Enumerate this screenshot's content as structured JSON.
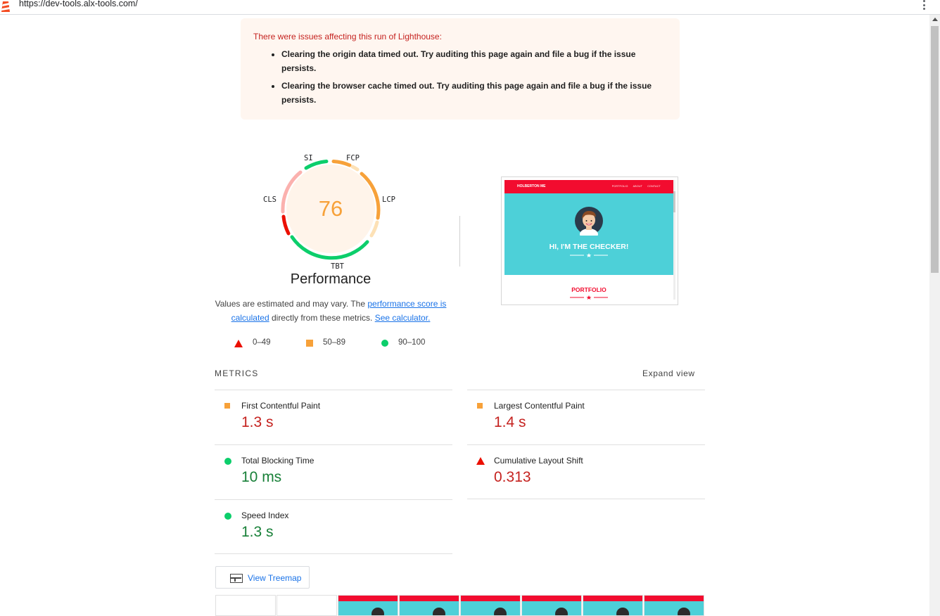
{
  "browser": {
    "url": "https://dev-tools.alx-tools.com/"
  },
  "warning": {
    "title": "There were issues affecting this run of Lighthouse:",
    "items": [
      "Clearing the origin data timed out. Try auditing this page again and file a bug if the issue persists.",
      "Clearing the browser cache timed out. Try auditing this page again and file a bug if the issue persists."
    ]
  },
  "gauge": {
    "score": "76",
    "title": "Performance",
    "labels": {
      "si": "SI",
      "fcp": "FCP",
      "lcp": "LCP",
      "tbt": "TBT",
      "cls": "CLS"
    }
  },
  "description": {
    "text1": "Values are estimated and may vary. The ",
    "link1": "performance score is calculated",
    "text2": " directly from these metrics. ",
    "link2": "See calculator."
  },
  "legend": {
    "fail": "0–49",
    "average": "50–89",
    "pass": "90–100"
  },
  "screenshot": {
    "brand": "HOLBERTON ME",
    "nav": [
      "PORTFOLIO",
      "ABOUT",
      "CONTACT"
    ],
    "hero": "HI, I'M THE CHECKER!",
    "section": "PORTFOLIO"
  },
  "metrics": {
    "header": "METRICS",
    "expand": "Expand view",
    "fcp": {
      "name": "First Contentful Paint",
      "value": "1.3 s",
      "rating": "average"
    },
    "lcp": {
      "name": "Largest Contentful Paint",
      "value": "1.4 s",
      "rating": "average"
    },
    "tbt": {
      "name": "Total Blocking Time",
      "value": "10 ms",
      "rating": "pass"
    },
    "cls": {
      "name": "Cumulative Layout Shift",
      "value": "0.313",
      "rating": "fail"
    },
    "si": {
      "name": "Speed Index",
      "value": "1.3 s",
      "rating": "pass"
    }
  },
  "treemap": {
    "label": "View Treemap"
  },
  "colors": {
    "fail": "#eb0f00",
    "average": "#f7a139",
    "pass": "#0cce6b",
    "link": "#1a73e8"
  }
}
